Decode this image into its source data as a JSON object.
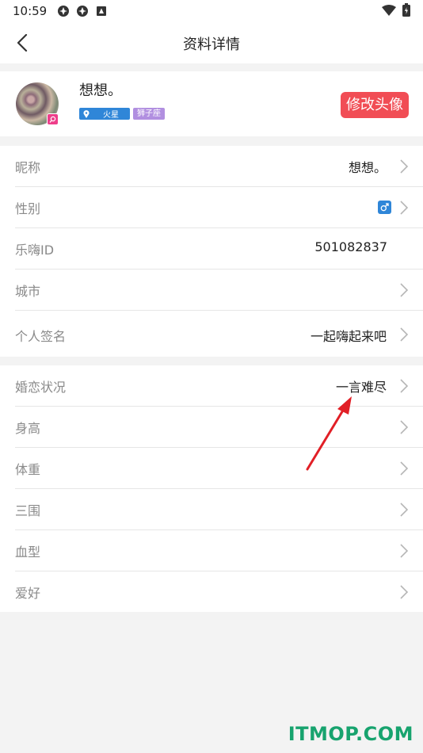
{
  "status_bar": {
    "time": "10:59",
    "icons": [
      "app-icon",
      "app-icon",
      "notification-icon"
    ],
    "right_icons": [
      "wifi-icon",
      "battery-icon"
    ]
  },
  "nav": {
    "title": "资料详情",
    "back_icon": "chevron-left-icon"
  },
  "profile": {
    "nickname": "想想。",
    "location_tag": "火星",
    "zodiac_tag": "狮子座",
    "edit_avatar_label": "修改头像",
    "colors": {
      "location_tag": "#2f86d8",
      "zodiac_tag": "#b18fe0",
      "edit_button": "#f14d55",
      "avatar_badge": "#ee3e8a"
    }
  },
  "basic_info": [
    {
      "label": "昵称",
      "value": "想想。",
      "chevron": true
    },
    {
      "label": "性别",
      "value": "",
      "gender": "male",
      "chevron": true
    },
    {
      "label": "乐嗨ID",
      "value": "501082837",
      "chevron": false
    },
    {
      "label": "城市",
      "value": "",
      "chevron": true
    },
    {
      "label": "个人签名",
      "value": "一起嗨起来吧",
      "chevron": true
    }
  ],
  "detail_info": [
    {
      "label": "婚恋状况",
      "value": "一言难尽",
      "chevron": true
    },
    {
      "label": "身高",
      "value": "",
      "chevron": true
    },
    {
      "label": "体重",
      "value": "",
      "chevron": true
    },
    {
      "label": "三围",
      "value": "",
      "chevron": true
    },
    {
      "label": "血型",
      "value": "",
      "chevron": true
    },
    {
      "label": "爱好",
      "value": "",
      "chevron": true
    }
  ],
  "watermark": "ITMOP.COM"
}
